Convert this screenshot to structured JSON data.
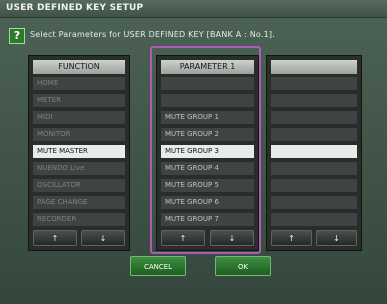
{
  "window": {
    "title": "USER DEFINED KEY SETUP"
  },
  "help_icon": "?",
  "instruction": "Select Parameters for USER DEFINED KEY [BANK A : No.1].",
  "function": {
    "header": "FUNCTION",
    "items": [
      "HOME",
      "METER",
      "MIDI",
      "MONITOR",
      "MUTE MASTER",
      "NUENDO Live",
      "OSCILLATOR",
      "PAGE CHANGE",
      "RECORDER"
    ],
    "selected_index": 4
  },
  "param1": {
    "header": "PARAMETER 1",
    "items": [
      "",
      "",
      "MUTE GROUP 1",
      "MUTE GROUP 2",
      "MUTE GROUP 3",
      "MUTE GROUP 4",
      "MUTE GROUP 5",
      "MUTE GROUP 6",
      "MUTE GROUP 7"
    ],
    "selected_index": 4
  },
  "param2": {
    "header": "",
    "items": [
      "",
      "",
      "",
      "",
      "",
      "",
      "",
      "",
      ""
    ],
    "selected_index": 4
  },
  "arrows": {
    "up": "↑",
    "down": "↓"
  },
  "buttons": {
    "cancel": "CANCEL",
    "ok": "OK"
  },
  "colors": {
    "highlight_border": "#b05bb6",
    "button_green": "#2f7a32",
    "selected_row": "#e8ece9"
  }
}
